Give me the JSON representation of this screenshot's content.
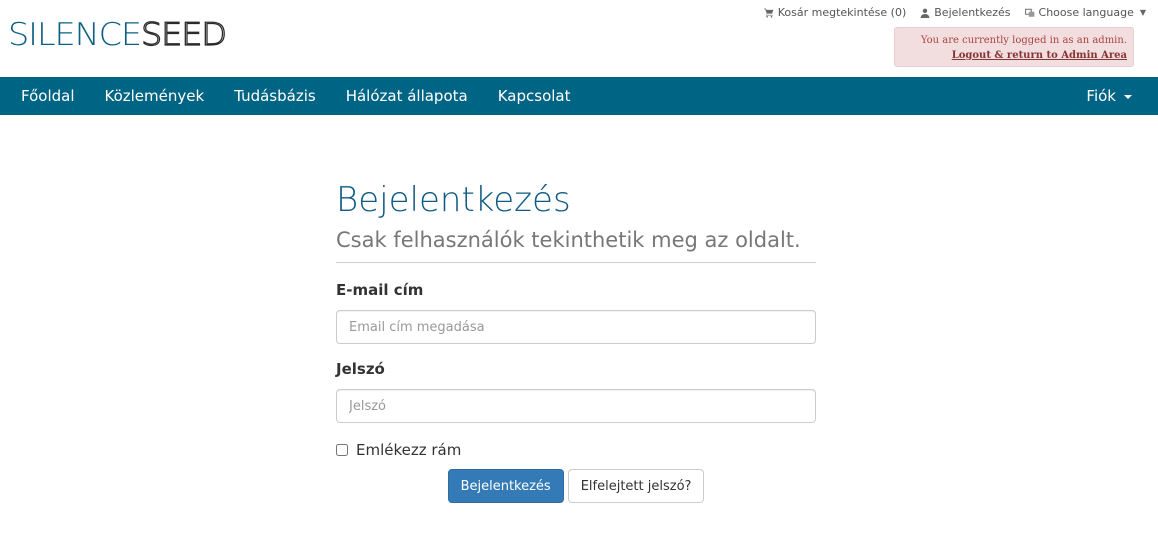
{
  "header": {
    "logo_part1": "SILENCE",
    "logo_part2": "SEED",
    "toplinks": {
      "cart": "Kosár megtekintése (0)",
      "login": "Bejelentkezés",
      "language": "Choose language"
    },
    "admin_alert": {
      "message": "You are currently logged in as an admin.",
      "link": "Logout & return to Admin Area"
    }
  },
  "nav": {
    "items": [
      "Főoldal",
      "Közlemények",
      "Tudásbázis",
      "Hálózat állapota",
      "Kapcsolat"
    ],
    "account": "Fiók"
  },
  "main": {
    "title": "Bejelentkezés",
    "subtitle": "Csak felhasználók tekinthetik meg az oldalt.",
    "email_label": "E-mail cím",
    "email_placeholder": "Email cím megadása",
    "password_label": "Jelszó",
    "password_placeholder": "Jelszó",
    "remember_label": "Emlékezz rám",
    "login_button": "Bejelentkezés",
    "forgot_button": "Elfelejtett jelszó?"
  },
  "colors": {
    "navbar": "#006484",
    "title": "#0d5a82",
    "primary_button": "#337ab7",
    "alert_bg": "#f2dede"
  }
}
